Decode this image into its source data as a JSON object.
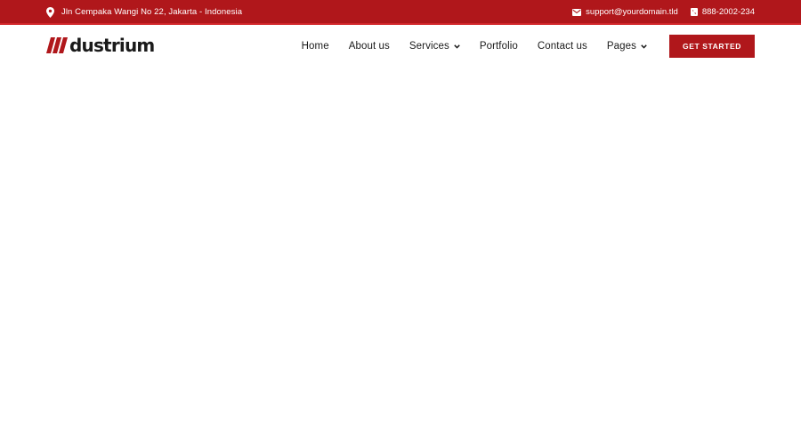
{
  "topbar": {
    "address": "Jln Cempaka Wangi No 22, Jakarta - Indonesia",
    "email": "support@yourdomain.tld",
    "phone": "888-2002-234",
    "icons": {
      "address": "map-pin-icon",
      "email": "mail-icon",
      "phone": "phone-icon"
    },
    "background": "#b0171b"
  },
  "header": {
    "logo_text": "dustrium",
    "logo_mark": "triple-slash-logo-mark",
    "nav": [
      {
        "label": "Home",
        "has_dropdown": false
      },
      {
        "label": "About us",
        "has_dropdown": false
      },
      {
        "label": "Services",
        "has_dropdown": true
      },
      {
        "label": "Portfolio",
        "has_dropdown": false
      },
      {
        "label": "Contact us",
        "has_dropdown": false
      },
      {
        "label": "Pages",
        "has_dropdown": true
      }
    ],
    "cta_label": "GET STARTED",
    "accent": "#b0171b"
  }
}
